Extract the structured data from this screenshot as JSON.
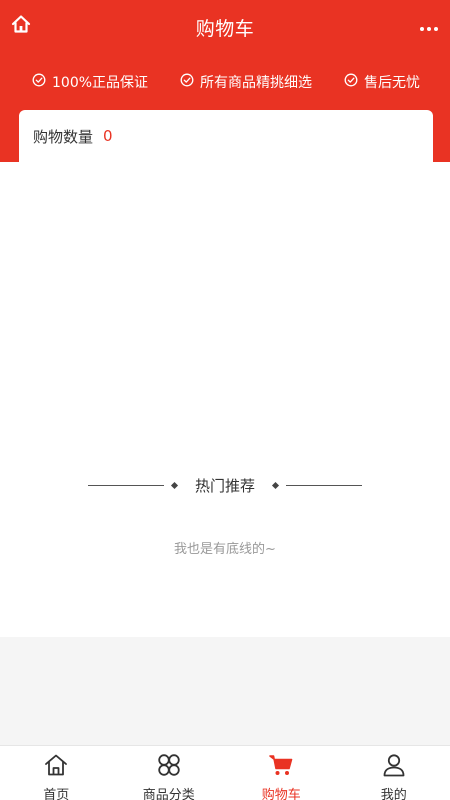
{
  "header": {
    "title": "购物车",
    "home_icon": "home-icon",
    "more_icon": "more-dots-icon",
    "background": "#e93323"
  },
  "guarantees": [
    {
      "label": "100%正品保证",
      "icon": "check-circle-icon"
    },
    {
      "label": "所有商品精挑细选",
      "icon": "check-circle-icon"
    },
    {
      "label": "售后无忧",
      "icon": "check-circle-icon"
    }
  ],
  "cart": {
    "count_label": "购物数量",
    "count_value": "0"
  },
  "recommend": {
    "title": "热门推荐",
    "bottom_note": "我也是有底线的~"
  },
  "tabbar": {
    "items": [
      {
        "label": "首页",
        "icon": "home-icon",
        "active": false
      },
      {
        "label": "商品分类",
        "icon": "category-icon",
        "active": false
      },
      {
        "label": "购物车",
        "icon": "cart-icon",
        "active": true
      },
      {
        "label": "我的",
        "icon": "user-icon",
        "active": false
      }
    ],
    "active_color": "#e93323"
  }
}
